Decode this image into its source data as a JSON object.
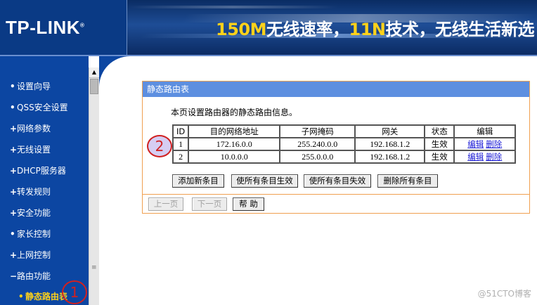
{
  "header": {
    "logo_text": "TP-LINK",
    "logo_mark": "®",
    "slogan_part1": "150M",
    "slogan_part2": "无线速率，",
    "slogan_part3": "11N",
    "slogan_part4": "技术，无线生活新选"
  },
  "sidebar": {
    "items": [
      {
        "label": "设置向导",
        "bullet": "•"
      },
      {
        "label": "QSS安全设置",
        "bullet": "•"
      },
      {
        "label": "网络参数",
        "bullet": "+"
      },
      {
        "label": "无线设置",
        "bullet": "+"
      },
      {
        "label": "DHCP服务器",
        "bullet": "+"
      },
      {
        "label": "转发规则",
        "bullet": "+"
      },
      {
        "label": "安全功能",
        "bullet": "+"
      },
      {
        "label": "家长控制",
        "bullet": "•"
      },
      {
        "label": "上网控制",
        "bullet": "+"
      },
      {
        "label": "路由功能",
        "bullet": "−"
      },
      {
        "label": "静态路由表",
        "bullet": "•",
        "active": true
      }
    ]
  },
  "panel": {
    "title": "静态路由表",
    "description": "本页设置路由器的静态路由信息。",
    "table": {
      "headers": [
        "ID",
        "目的网络地址",
        "子网掩码",
        "网关",
        "状态",
        "编辑"
      ],
      "rows": [
        {
          "id": "1",
          "dest": "172.16.0.0",
          "mask": "255.240.0.0",
          "gateway": "192.168.1.2",
          "status": "生效",
          "edit": "编辑",
          "delete": "删除"
        },
        {
          "id": "2",
          "dest": "10.0.0.0",
          "mask": "255.0.0.0",
          "gateway": "192.168.1.2",
          "status": "生效",
          "edit": "编辑",
          "delete": "删除"
        }
      ]
    },
    "actions": {
      "add": "添加新条目",
      "enable_all": "使所有条目生效",
      "disable_all": "使所有条目失效",
      "delete_all": "删除所有条目"
    },
    "nav": {
      "prev": "上一页",
      "next": "下一页",
      "help": "帮 助"
    }
  },
  "annotations": {
    "marker1": "1",
    "marker2": "2"
  },
  "watermark": "@51CTO博客",
  "colors": {
    "header_blue": "#0c3f8a",
    "sidebar_blue": "#0c46a2",
    "panel_title_bg": "#5d8fe0",
    "panel_border": "#f0a050",
    "active_menu": "#ffd21a",
    "link": "#1b1bd6",
    "annotation_red": "#d02020"
  }
}
